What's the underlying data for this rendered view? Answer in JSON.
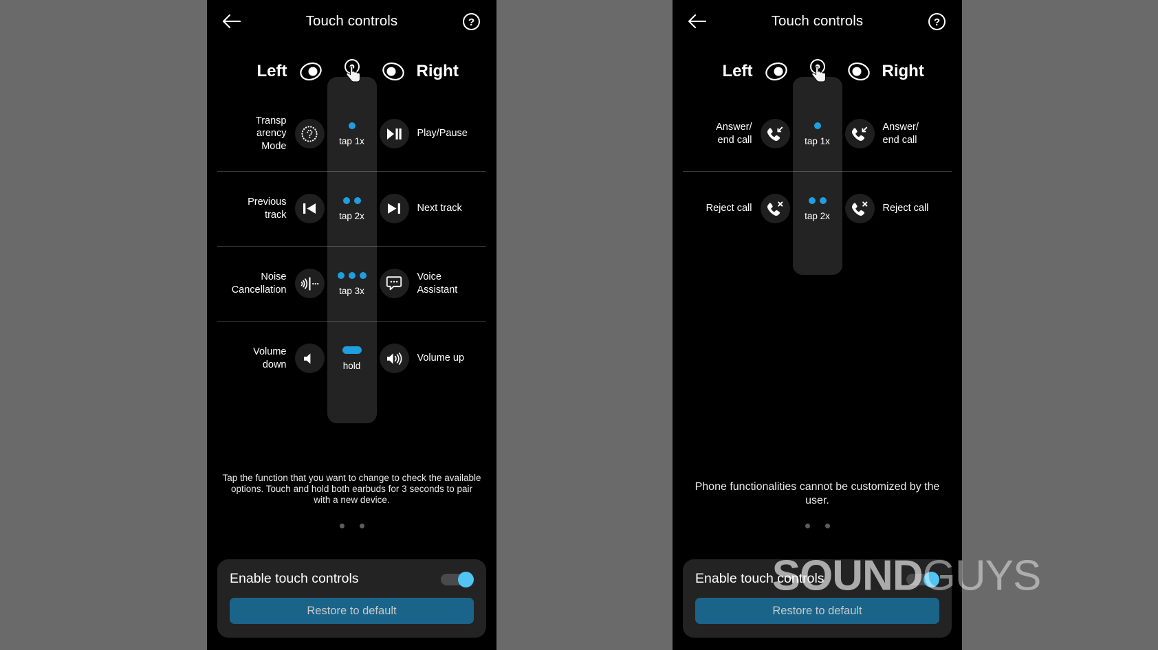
{
  "background_color": "#6a6a6a",
  "accent_blue": "#1f9ee0",
  "toggle_on_color": "#51c4f2",
  "button_color": "#1a6489",
  "watermark": {
    "bold": "SOUND",
    "light": "GUYS"
  },
  "screens": [
    {
      "id": "media-controls",
      "appbar": {
        "title": "Touch controls",
        "back_icon": "arrow-left-icon",
        "help_icon": "question-mark-circle-icon"
      },
      "earbuds_header": {
        "left_label": "Left",
        "right_label": "Right",
        "left_icon": "earbud-icon",
        "right_icon": "earbud-icon",
        "center_icon": "touch-tap-icon"
      },
      "rows": [
        {
          "left": {
            "label": "Transp\narency\nMode",
            "icon": "transparency-mode-icon"
          },
          "gesture": {
            "label": "tap 1x",
            "type": "dots",
            "count": 1
          },
          "right": {
            "label": "Play/Pause",
            "icon": "play-pause-icon"
          }
        },
        {
          "left": {
            "label": "Previous\ntrack",
            "icon": "previous-track-icon"
          },
          "gesture": {
            "label": "tap 2x",
            "type": "dots",
            "count": 2
          },
          "right": {
            "label": "Next track",
            "icon": "next-track-icon"
          }
        },
        {
          "left": {
            "label": "Noise\nCancellation",
            "icon": "noise-cancellation-icon"
          },
          "gesture": {
            "label": "tap 3x",
            "type": "dots",
            "count": 3
          },
          "right": {
            "label": "Voice\nAssistant",
            "icon": "voice-assistant-icon"
          }
        },
        {
          "left": {
            "label": "Volume\ndown",
            "icon": "volume-down-icon"
          },
          "gesture": {
            "label": "hold",
            "type": "bar",
            "count": 0
          },
          "right": {
            "label": "Volume up",
            "icon": "volume-up-icon"
          }
        }
      ],
      "hint": "Tap the function that you want to change to check the available options. Touch and hold both earbuds for 3 seconds to pair with a new device.",
      "pager": {
        "count": 2,
        "active": 0
      },
      "card": {
        "title": "Enable touch controls",
        "toggle_state": "on",
        "button_label": "Restore to default"
      }
    },
    {
      "id": "call-controls",
      "appbar": {
        "title": "Touch controls",
        "back_icon": "arrow-left-icon",
        "help_icon": "question-mark-circle-icon"
      },
      "earbuds_header": {
        "left_label": "Left",
        "right_label": "Right",
        "left_icon": "earbud-icon",
        "right_icon": "earbud-icon",
        "center_icon": "touch-tap-icon"
      },
      "rows": [
        {
          "left": {
            "label": "Answer/\nend call",
            "icon": "answer-call-icon"
          },
          "gesture": {
            "label": "tap 1x",
            "type": "dots",
            "count": 1
          },
          "right": {
            "label": "Answer/\nend call",
            "icon": "answer-call-icon"
          }
        },
        {
          "left": {
            "label": "Reject call",
            "icon": "reject-call-icon"
          },
          "gesture": {
            "label": "tap 2x",
            "type": "dots",
            "count": 2
          },
          "right": {
            "label": "Reject call",
            "icon": "reject-call-icon"
          }
        }
      ],
      "hint": "Phone functionalities cannot be customized by the user.",
      "pager": {
        "count": 2,
        "active": 1
      },
      "card": {
        "title": "Enable touch controls",
        "toggle_state": "on",
        "button_label": "Restore to default"
      }
    }
  ]
}
